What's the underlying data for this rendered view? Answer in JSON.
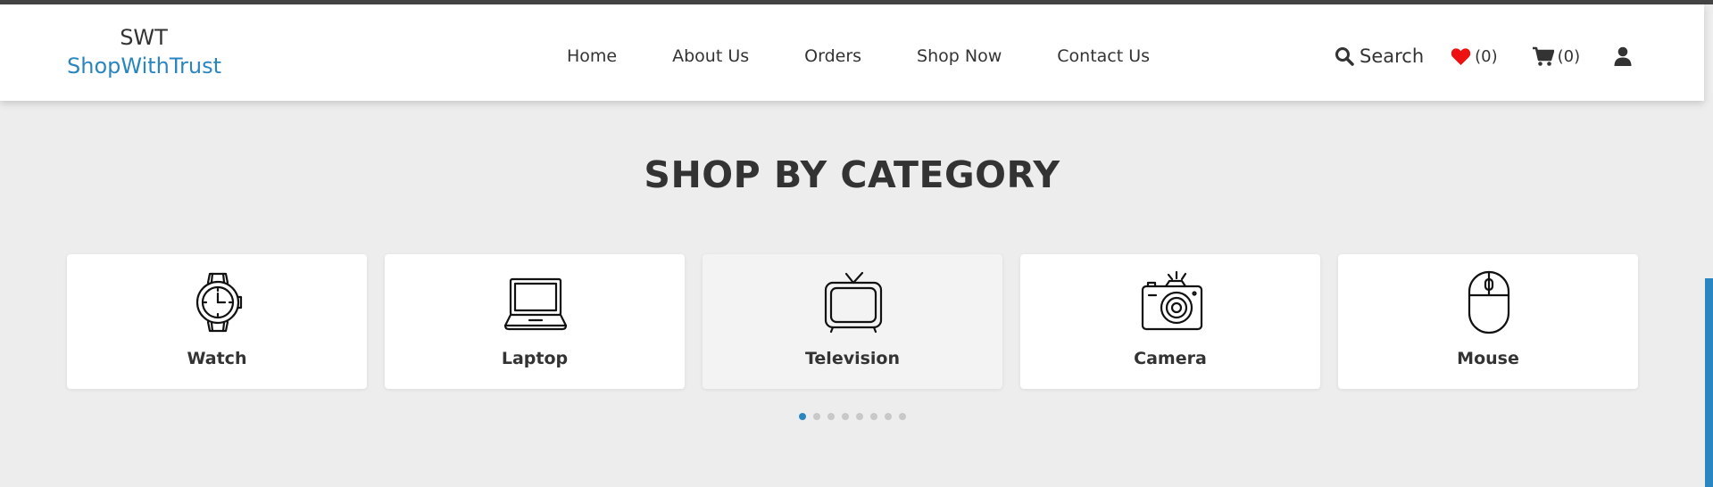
{
  "brand": {
    "short": "SWT",
    "name": "ShopWithTrust",
    "accent_color": "#2a86c0"
  },
  "nav": {
    "items": [
      {
        "label": "Home"
      },
      {
        "label": "About Us"
      },
      {
        "label": "Orders"
      },
      {
        "label": "Shop Now"
      },
      {
        "label": "Contact Us"
      }
    ]
  },
  "header_actions": {
    "search_label": "Search",
    "wishlist_count": "(0)",
    "cart_count": "(0)",
    "icons": [
      "search-icon",
      "heart-icon",
      "cart-icon",
      "user-icon"
    ],
    "heart_color": "#e11"
  },
  "section": {
    "title": "SHOP BY CATEGORY"
  },
  "categories": [
    {
      "label": "Watch",
      "icon": "watch-icon"
    },
    {
      "label": "Laptop",
      "icon": "laptop-icon"
    },
    {
      "label": "Television",
      "icon": "television-icon"
    },
    {
      "label": "Camera",
      "icon": "camera-icon"
    },
    {
      "label": "Mouse",
      "icon": "mouse-icon"
    }
  ],
  "carousel": {
    "page_count": 8,
    "active_page": 1
  }
}
